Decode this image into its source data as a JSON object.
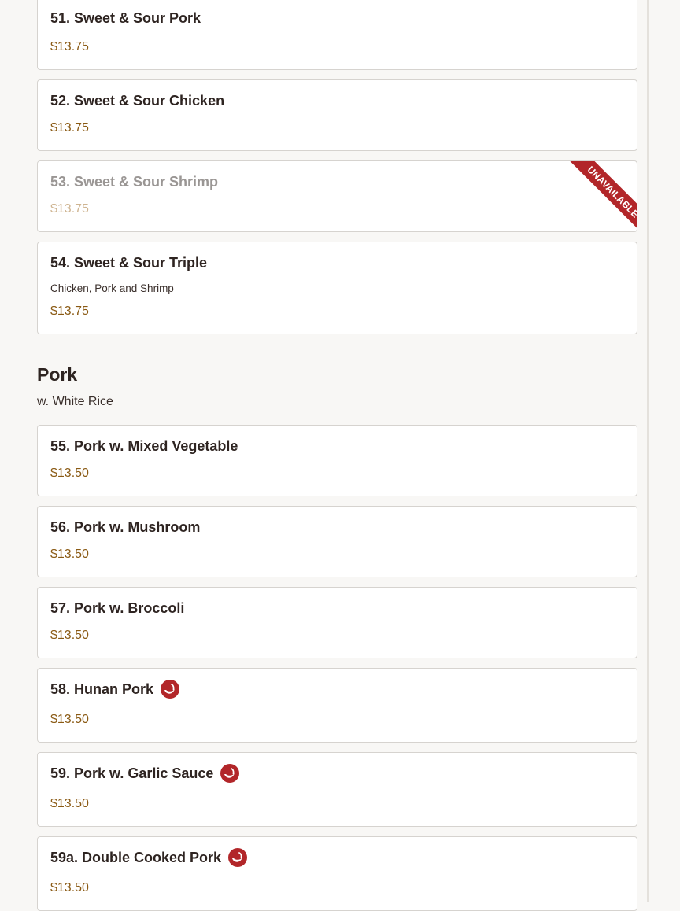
{
  "sweet_sour_items": [
    {
      "name": "51. Sweet & Sour Pork",
      "price": "$13.75"
    },
    {
      "name": "52. Sweet & Sour Chicken",
      "price": "$13.75"
    },
    {
      "name": "53. Sweet & Sour Shrimp",
      "price": "$13.75",
      "badge": "UNAVAILABLE"
    },
    {
      "name": "54. Sweet & Sour Triple",
      "description": "Chicken, Pork and Shrimp",
      "price": "$13.75"
    }
  ],
  "pork_section": {
    "title": "Pork",
    "subtitle": "w. White Rice",
    "items": [
      {
        "name": "55. Pork w. Mixed Vegetable",
        "price": "$13.50"
      },
      {
        "name": "56. Pork w. Mushroom",
        "price": "$13.50"
      },
      {
        "name": "57. Pork w. Broccoli",
        "price": "$13.50"
      },
      {
        "name": "58. Hunan Pork",
        "price": "$13.50",
        "icon": "spicy-icon"
      },
      {
        "name": "59. Pork w. Garlic Sauce",
        "price": "$13.50",
        "icon": "spicy-icon"
      },
      {
        "name": "59a. Double Cooked Pork",
        "price": "$13.50",
        "icon": "spicy-icon"
      }
    ]
  },
  "colors": {
    "accent_red": "#b22629",
    "price_brown": "#8a5a14",
    "text_dark": "#2e2421"
  }
}
